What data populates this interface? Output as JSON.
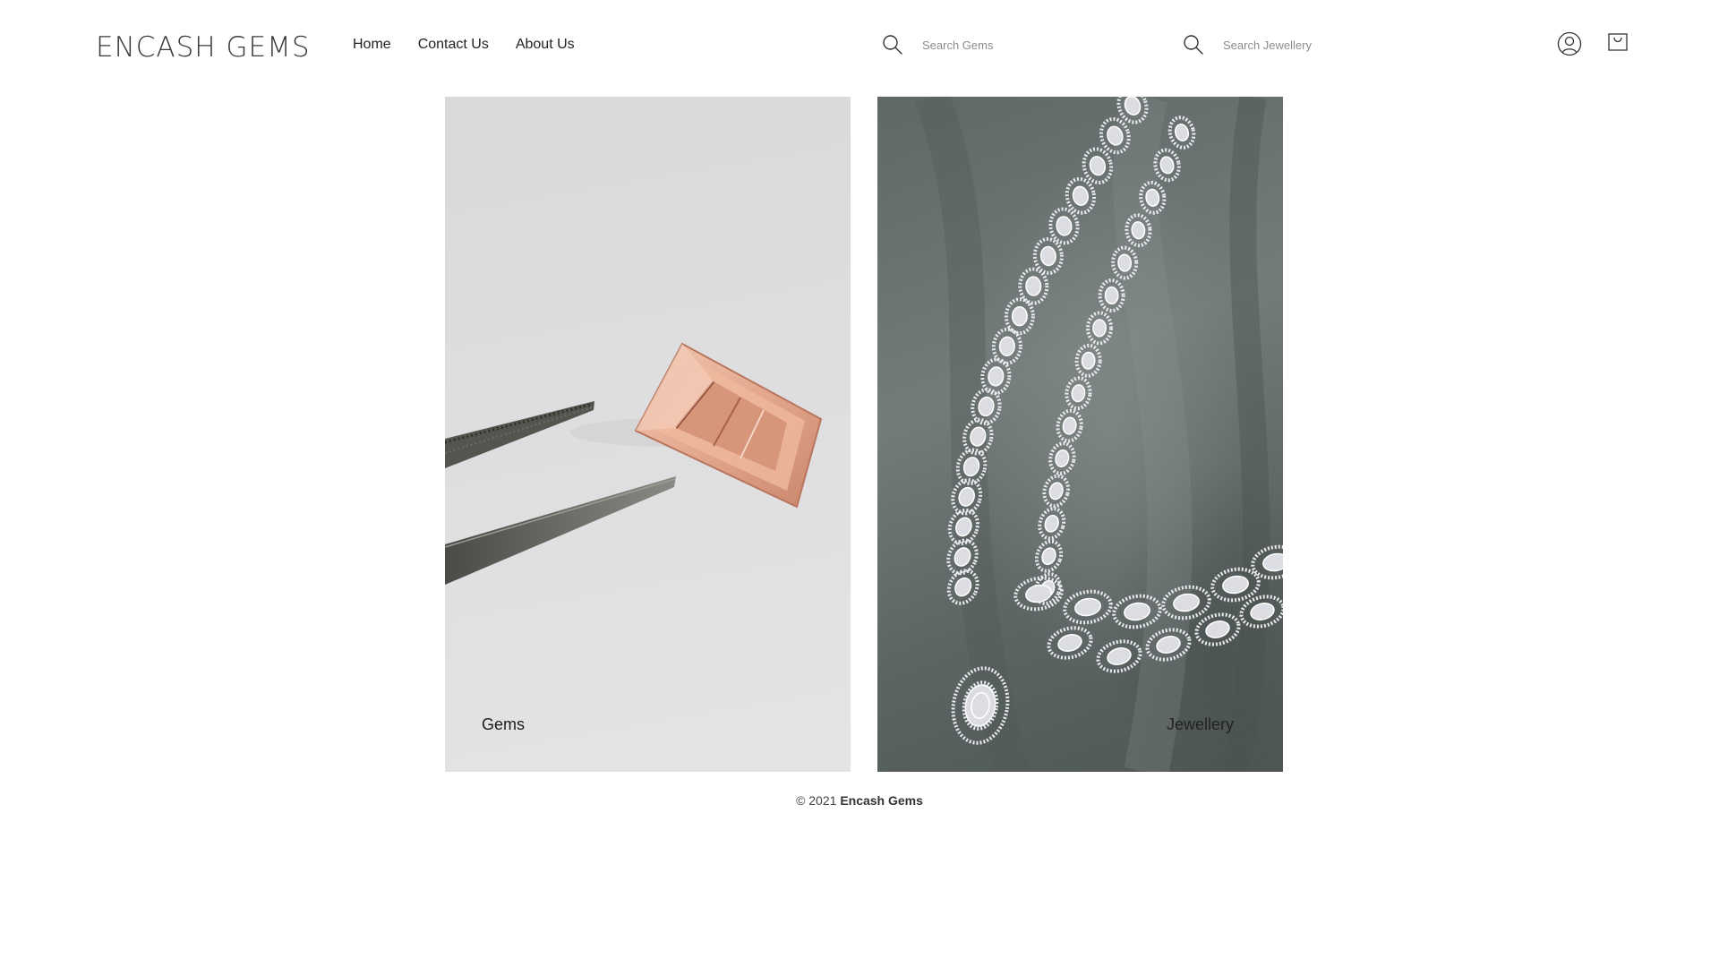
{
  "brand": {
    "logo_text": "ENCASH GEMS"
  },
  "nav": {
    "items": [
      {
        "label": "Home"
      },
      {
        "label": "Contact Us"
      },
      {
        "label": "About Us"
      }
    ]
  },
  "search": {
    "gems_placeholder": "Search Gems",
    "jewellery_placeholder": "Search Jewellery"
  },
  "icons": {
    "search": "search-icon",
    "user": "user-icon",
    "cart": "cart-icon"
  },
  "categories": [
    {
      "label": "Gems",
      "image": "morganite-gem-with-tweezers"
    },
    {
      "label": "Jewellery",
      "image": "diamond-necklace-on-grey-satin"
    }
  ],
  "footer": {
    "copyright": "© 2021",
    "company": "Encash Gems"
  },
  "colors": {
    "text": "#222222",
    "placeholder": "#8c8c8c",
    "gem": "#e3a88d",
    "satin": "#687170"
  }
}
